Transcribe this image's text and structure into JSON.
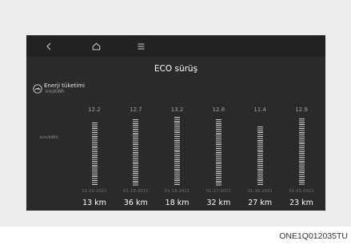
{
  "nav": {
    "back_icon": "back-icon",
    "home_icon": "home-icon",
    "menu_icon": "menu-icon"
  },
  "header": {
    "title": "ECO sürüş"
  },
  "section": {
    "icon": "gauge-icon"
  },
  "chart_data": {
    "type": "bar",
    "title": "Enerji tüketimi",
    "unit": "km/kWh",
    "ylabel": "km/kWh",
    "categories": [
      "01-19-2021",
      "01-18-2021",
      "01-18-2021",
      "01-17-2021",
      "01-16-2021",
      "01-15-2021"
    ],
    "values": [
      12.2,
      12.7,
      13.2,
      12.8,
      11.4,
      12.9
    ],
    "distances": [
      "13 km",
      "36 km",
      "18 km",
      "32 km",
      "27 km",
      "23 km"
    ],
    "grid": false
  },
  "figure_code": "ONE1Q012035TU",
  "colors": {
    "frame": "#ececec",
    "screen": "#2a2a2a",
    "nav": "#222222",
    "bar": "#cfcfcf",
    "text": "#ffffff"
  }
}
